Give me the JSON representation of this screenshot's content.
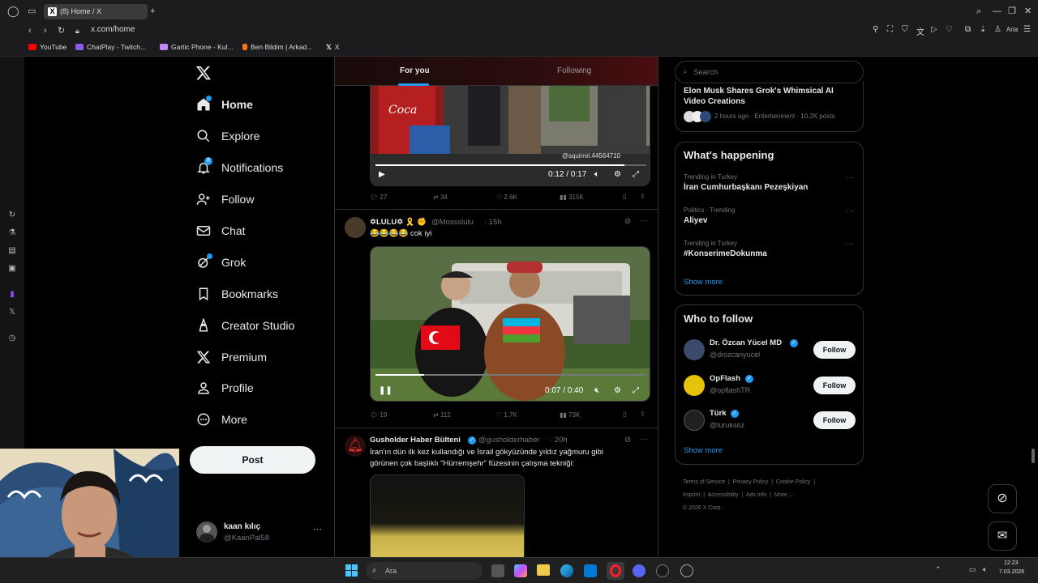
{
  "browser": {
    "tab_title": "(8) Home / X",
    "url": "x.com/home",
    "bookmarks": [
      {
        "label": "YouTube",
        "color": "#ff0000"
      },
      {
        "label": "ChatPlay - Twitch...",
        "color": "#8a5cf6"
      },
      {
        "label": "Gartic Phone - Kul...",
        "color": "#c084fc"
      },
      {
        "label": "Ben Bildim | Arkad...",
        "color": "#f97316"
      },
      {
        "label": "X",
        "color": "#ffffff"
      }
    ],
    "aria_label": "Aria"
  },
  "nav": {
    "items": [
      {
        "label": "Home",
        "icon": "home-icon"
      },
      {
        "label": "Explore",
        "icon": "search-icon"
      },
      {
        "label": "Notifications",
        "icon": "bell-icon"
      },
      {
        "label": "Follow",
        "icon": "add-person-icon"
      },
      {
        "label": "Chat",
        "icon": "mail-icon"
      },
      {
        "label": "Grok",
        "icon": "grok-icon"
      },
      {
        "label": "Bookmarks",
        "icon": "bookmark-icon"
      },
      {
        "label": "Creator Studio",
        "icon": "creator-icon"
      },
      {
        "label": "Premium",
        "icon": "x-icon"
      },
      {
        "label": "Profile",
        "icon": "person-icon"
      },
      {
        "label": "More",
        "icon": "more-circle-icon"
      }
    ],
    "notifications_badge": "8",
    "post_label": "Post",
    "account": {
      "name": "kaan kılıç",
      "handle": "@KaanPal58"
    }
  },
  "feed": {
    "tabs": [
      "For you",
      "Following"
    ],
    "tweet1": {
      "video_watermark": "@squirrel.44564710",
      "time": "0:12 / 0:17",
      "replies": "27",
      "reposts": "34",
      "likes": "2.6K",
      "views": "315K",
      "progress": 0.92
    },
    "tweet2": {
      "name": "✡LULU✡ 🎗️ ✊",
      "handle": "@Mossslulu",
      "age": "· 15h",
      "text": "😂😂😂😂 cok iyi",
      "time": "0:07 / 0:40",
      "replies": "19",
      "reposts": "112",
      "likes": "1.7K",
      "views": "73K",
      "progress": 0.18
    },
    "tweet3": {
      "name": "Gusholder Haber Bülteni",
      "handle": "@gusholderhaber",
      "age": "· 20h",
      "text": "İran'ın dün ilk kez kullandığı ve İsrail gökyüzünde yıldız yağmuru gibi görünen çok başlıklı \"Hürremşehr\" füzesinin çalışma tekniği:"
    }
  },
  "right": {
    "search_placeholder": "Search",
    "trend_top": {
      "title": "Elon Musk Shares Grok's Whimsical AI Video Creations",
      "meta": "2 hours ago · Entertainment · 10.2K posts"
    },
    "happening_title": "What's happening",
    "trends": [
      {
        "context": "Trending in Turkey",
        "title": "İran Cumhurbaşkanı Pezeşkiyan"
      },
      {
        "context": "Politics · Trending",
        "title": "Aliyev"
      },
      {
        "context": "Trending in Turkey",
        "title": "#KonserimeDokunma"
      }
    ],
    "show_more": "Show more",
    "who_title": "Who to follow",
    "who": [
      {
        "name": "Dr. Özcan Yücel MD",
        "handle": "@drozcanyucel",
        "btn": "Follow"
      },
      {
        "name": "OpFlash",
        "handle": "@opflashTR",
        "btn": "Follow"
      },
      {
        "name": "Türk",
        "handle": "@turuksoz",
        "btn": "Follow"
      }
    ],
    "footer": [
      "Terms of Service",
      "Privacy Policy",
      "Cookie Policy",
      "Imprint",
      "Accessibility",
      "Ads info",
      "More ...",
      "© 2026 X Corp."
    ]
  },
  "taskbar": {
    "search_placeholder": "Ara",
    "clock_time": "12:23",
    "clock_date": "7.03.2026"
  },
  "colors": {
    "accent": "#1d9bf0",
    "background": "#000000",
    "border": "#2f3336"
  }
}
